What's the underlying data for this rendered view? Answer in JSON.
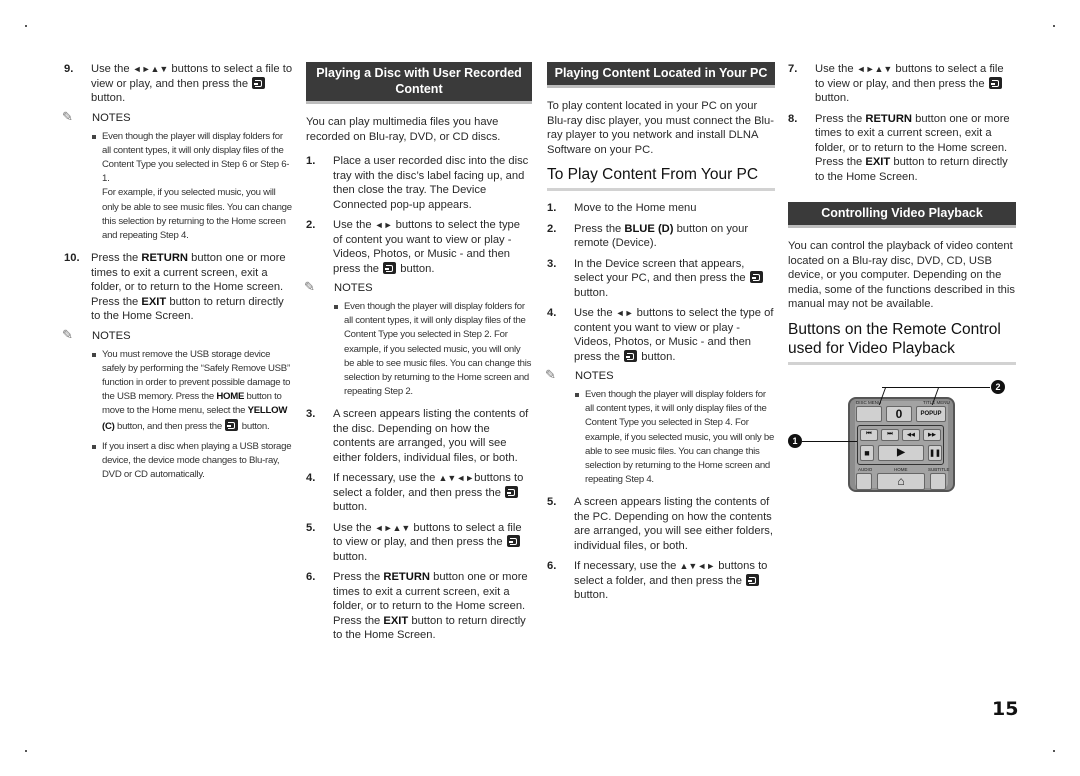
{
  "page_number": "15",
  "col1": {
    "step9": {
      "num": "9.",
      "pre": "Use the ",
      "arrows": "◄►▲▼",
      "post": " buttons to select a file to view or play, and then press the ",
      "end": " button."
    },
    "notes1_label": "NOTES",
    "notes1": [
      "Even though the player will display folders for all content types, it will only display files of the Content Type you selected in Step 6 or Step 6-1.",
      "For example, if you selected music, you will only be able to see music files. You can change this selection by returning to the Home screen and repeating Step 4."
    ],
    "step10": {
      "num": "10.",
      "a": "Press the ",
      "kw1": "RETURN",
      "b": " button one or more times to exit a current screen, exit a folder, or to return to the Home screen. Press the ",
      "kw2": "EXIT",
      "c": " button to return directly to the Home Screen."
    },
    "notes2_label": "NOTES",
    "notes2": {
      "n1": {
        "a": "You must remove the USB storage device safely by performing the “Safely Remove USB” function in order to prevent possible damage to the USB memory. Press the ",
        "kw1": "HOME",
        "b": " button to move to the Home menu, select the ",
        "kw2": "YELLOW (C)",
        "c": " button, and then press the ",
        "d": " button."
      },
      "n2": "If you insert a disc when playing a USB storage device, the device mode changes to Blu-ray, DVD or CD automatically."
    }
  },
  "col2": {
    "banner": "Playing a Disc with User Recorded Content",
    "intro": "You can play multimedia files you have recorded on Blu-ray, DVD, or CD discs.",
    "step1": {
      "num": "1.",
      "text": "Place a user recorded disc into the disc tray with the disc’s label facing up, and then close the tray. The Device Connected pop-up appears."
    },
    "step2": {
      "num": "2.",
      "pre": "Use the ",
      "arrows": "◄►",
      "post": " buttons to select the type of content you want to view or play - Videos, Photos, or Music - and then press the ",
      "end": " button."
    },
    "notes_label": "NOTES",
    "note": "Even though the player will display folders for all content types, it will only display files of the Content Type you selected in Step 2. For example, if you selected music, you will only be able to see music files. You can change this selection by returning to the Home screen and repeating Step 2.",
    "step3": {
      "num": "3.",
      "text": "A screen appears listing the contents of the disc. Depending on how the contents are arranged, you will see either folders, individual files, or both."
    },
    "step4": {
      "num": "4.",
      "pre": "If necessary, use the ",
      "arrows": "▲▼◄►",
      "post": "buttons to select a folder, and then press the ",
      "end": " button."
    },
    "step5": {
      "num": "5.",
      "pre": "Use the ",
      "arrows": "◄►▲▼",
      "post": " buttons to select a file to view or play, and then press the ",
      "end": " button."
    },
    "step6": {
      "num": "6.",
      "a": "Press the ",
      "kw1": "RETURN",
      "b": " button one or more times to exit a current screen, exit a folder, or to return to the Home screen. Press the ",
      "kw2": "EXIT",
      "c": " button to return directly to the Home Screen."
    }
  },
  "col3": {
    "banner": "Playing Content Located in Your PC",
    "intro": "To play content located in your PC on your Blu-ray disc player, you must connect the Blu-ray player to you network and install DLNA Software on your PC.",
    "heading": "To Play Content From Your PC",
    "step1": {
      "num": "1.",
      "text": "Move to the Home menu"
    },
    "step2": {
      "num": "2.",
      "a": "Press the ",
      "kw": "BLUE (D)",
      "b": " button on your remote (Device)."
    },
    "step3": {
      "num": "3.",
      "pre": "In the Device screen that appears, select your PC, and then press the ",
      "end": " button."
    },
    "step4": {
      "num": "4.",
      "pre": "Use the ",
      "arrows": "◄►",
      "post": " buttons to select the type of content you want to view or play - Videos, Photos, or Music - and then press the ",
      "end": " button."
    },
    "notes_label": "NOTES",
    "note": "Even though the player will display folders for all content types, it will only display files of the Content Type you selected in Step 4. For example, if you selected music, you will only be able to see music files. You can change this selection by returning to the Home screen and repeating Step 4.",
    "step5": {
      "num": "5.",
      "text": "A screen appears listing the contents of the PC. Depending on how the contents are arranged, you will see either folders, individual files, or both."
    },
    "step6": {
      "num": "6.",
      "pre": "If necessary, use the ",
      "arrows": "▲▼◄►",
      "post": " buttons to select a folder, and then press the ",
      "end": " button."
    }
  },
  "col4": {
    "step7": {
      "num": "7.",
      "pre": "Use the ",
      "arrows": "◄►▲▼",
      "post": " buttons to select a file to view or play, and then press the ",
      "end": " button."
    },
    "step8": {
      "num": "8.",
      "a": "Press the ",
      "kw1": "RETURN",
      "b": " button one or more times to exit a current screen, exit a folder, or to return to the Home screen. Press the ",
      "kw2": "EXIT",
      "c": " button to return directly to the Home Screen."
    },
    "banner": "Controlling Video Playback",
    "intro": "You can control the playback of video content located on a Blu-ray disc, DVD, CD, USB device, or you computer. Depending on the media, some of the functions described in this manual may not be available.",
    "heading": "Buttons on the Remote Control used for Video Playback",
    "remote": {
      "callout1": "1",
      "callout2": "2",
      "labels": {
        "disc_menu": "DISC MENU",
        "title_menu": "TITLE MENU",
        "popup": "POPUP",
        "zero": "0",
        "audio": "AUDIO",
        "home": "HOME",
        "subtitle": "SUBTITLE"
      },
      "glyphs": {
        "prev": "⏮",
        "next": "⏭",
        "rew": "◀◀",
        "ff": "▶▶",
        "stop": "■",
        "play": "▶",
        "pause": "❚❚",
        "home": "⌂"
      }
    }
  }
}
